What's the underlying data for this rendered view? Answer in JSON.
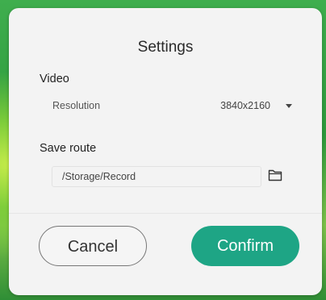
{
  "dialog": {
    "title": "Settings",
    "video": {
      "section_label": "Video",
      "resolution_label": "Resolution",
      "resolution_value": "3840x2160"
    },
    "save_route": {
      "section_label": "Save route",
      "path_value": "/Storage/Record"
    },
    "buttons": {
      "cancel_label": "Cancel",
      "confirm_label": "Confirm"
    },
    "colors": {
      "confirm_button": "#1ea585",
      "dialog_background": "#f3f3f3",
      "backdrop_green": "#2d9a3c"
    },
    "icons": {
      "browse": "folder-icon",
      "dropdown": "chevron-down-icon"
    }
  }
}
